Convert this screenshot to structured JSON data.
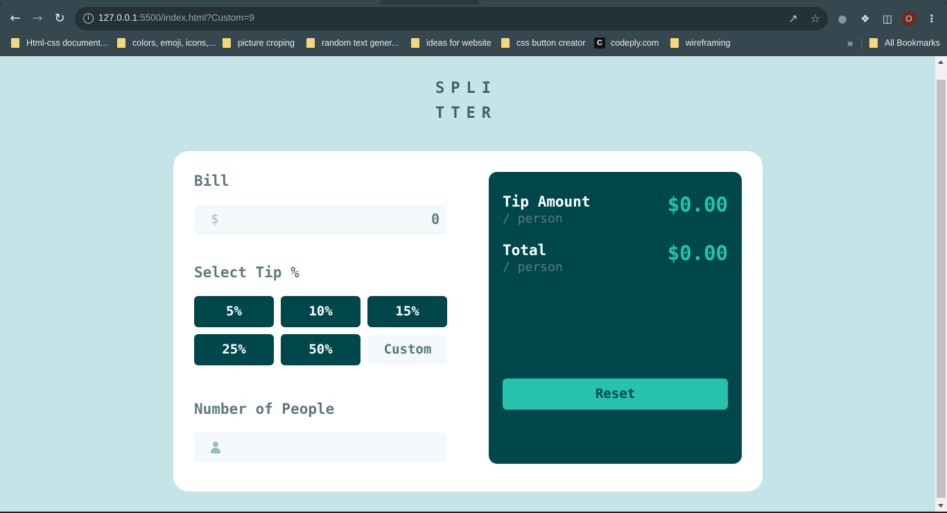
{
  "browser": {
    "url_host": "127.0.0.1",
    "url_rest": ":5500/index.html?Custom=9",
    "profile_initial": "O",
    "bookmarks": [
      {
        "label": "Html-css document..."
      },
      {
        "label": "colors, emoji, icons,..."
      },
      {
        "label": "picture croping"
      },
      {
        "label": "random text  gener..."
      },
      {
        "label": "ideas for website"
      },
      {
        "label": "css button creator"
      },
      {
        "label": "codeply.com"
      },
      {
        "label": "wireframing"
      }
    ],
    "overflow": "»",
    "all_bookmarks": "All Bookmarks"
  },
  "app": {
    "logo_line1": "SPLI",
    "logo_line2": "TTER",
    "bill": {
      "label": "Bill",
      "currency": "$",
      "value": "0"
    },
    "tip": {
      "label": "Select Tip %",
      "options": [
        "5%",
        "10%",
        "15%",
        "25%",
        "50%"
      ],
      "custom_placeholder": "Custom"
    },
    "people": {
      "label": "Number of People",
      "value": ""
    },
    "results": {
      "tip_label": "Tip Amount",
      "tip_sub": "/ person",
      "tip_value": "$0.00",
      "total_label": "Total",
      "total_sub": "/ person",
      "total_value": "$0.00",
      "reset_label": "Reset"
    }
  },
  "colors": {
    "page_bg": "#c5e4e7",
    "dark_cyan": "#00474b",
    "strong_cyan": "#26c2ad",
    "grayish_cyan": "#5e7a7d",
    "input_bg": "#f3f9fa"
  }
}
